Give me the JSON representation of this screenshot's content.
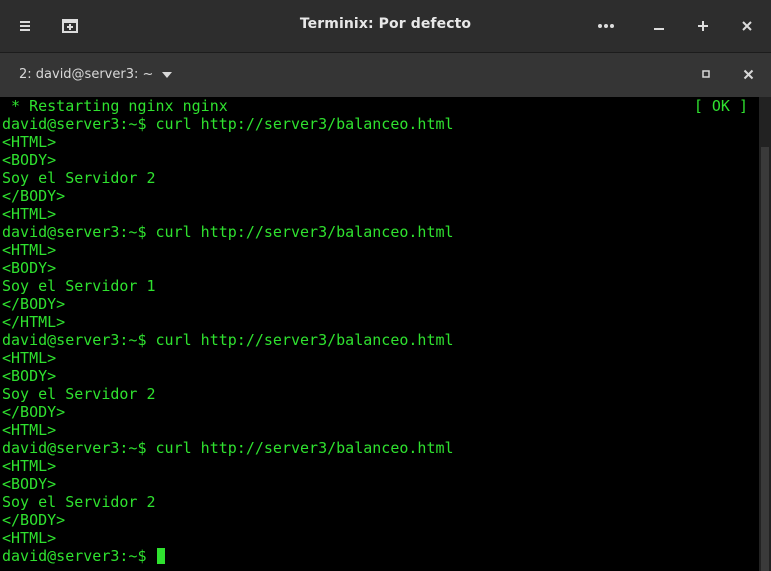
{
  "window": {
    "title": "Terminix: Por defecto"
  },
  "headerbar": {
    "left_icons": [
      "hamburger-icon",
      "new-session-icon"
    ],
    "right_icons": [
      "more-icon",
      "minimize-icon",
      "add-icon",
      "close-icon"
    ]
  },
  "session": {
    "title": "2: david@server3: ~"
  },
  "terminal": {
    "restart_line": " * Restarting nginx nginx",
    "ok_status": "[ OK ]",
    "lines": [
      "david@server3:~$ curl http://server3/balanceo.html",
      "<HTML>",
      "<BODY>",
      "Soy el Servidor 2",
      "</BODY>",
      "<HTML>",
      "david@server3:~$ curl http://server3/balanceo.html",
      "<HTML>",
      "<BODY>",
      "Soy el Servidor 1",
      "</BODY>",
      "</HTML>",
      "david@server3:~$ curl http://server3/balanceo.html",
      "<HTML>",
      "<BODY>",
      "Soy el Servidor 2",
      "</BODY>",
      "<HTML>",
      "david@server3:~$ curl http://server3/balanceo.html",
      "<HTML>",
      "<BODY>",
      "Soy el Servidor 2",
      "</BODY>",
      "<HTML>"
    ],
    "prompt": "david@server3:~$ ",
    "text_color": "#2fe12f",
    "background": "#000000"
  }
}
